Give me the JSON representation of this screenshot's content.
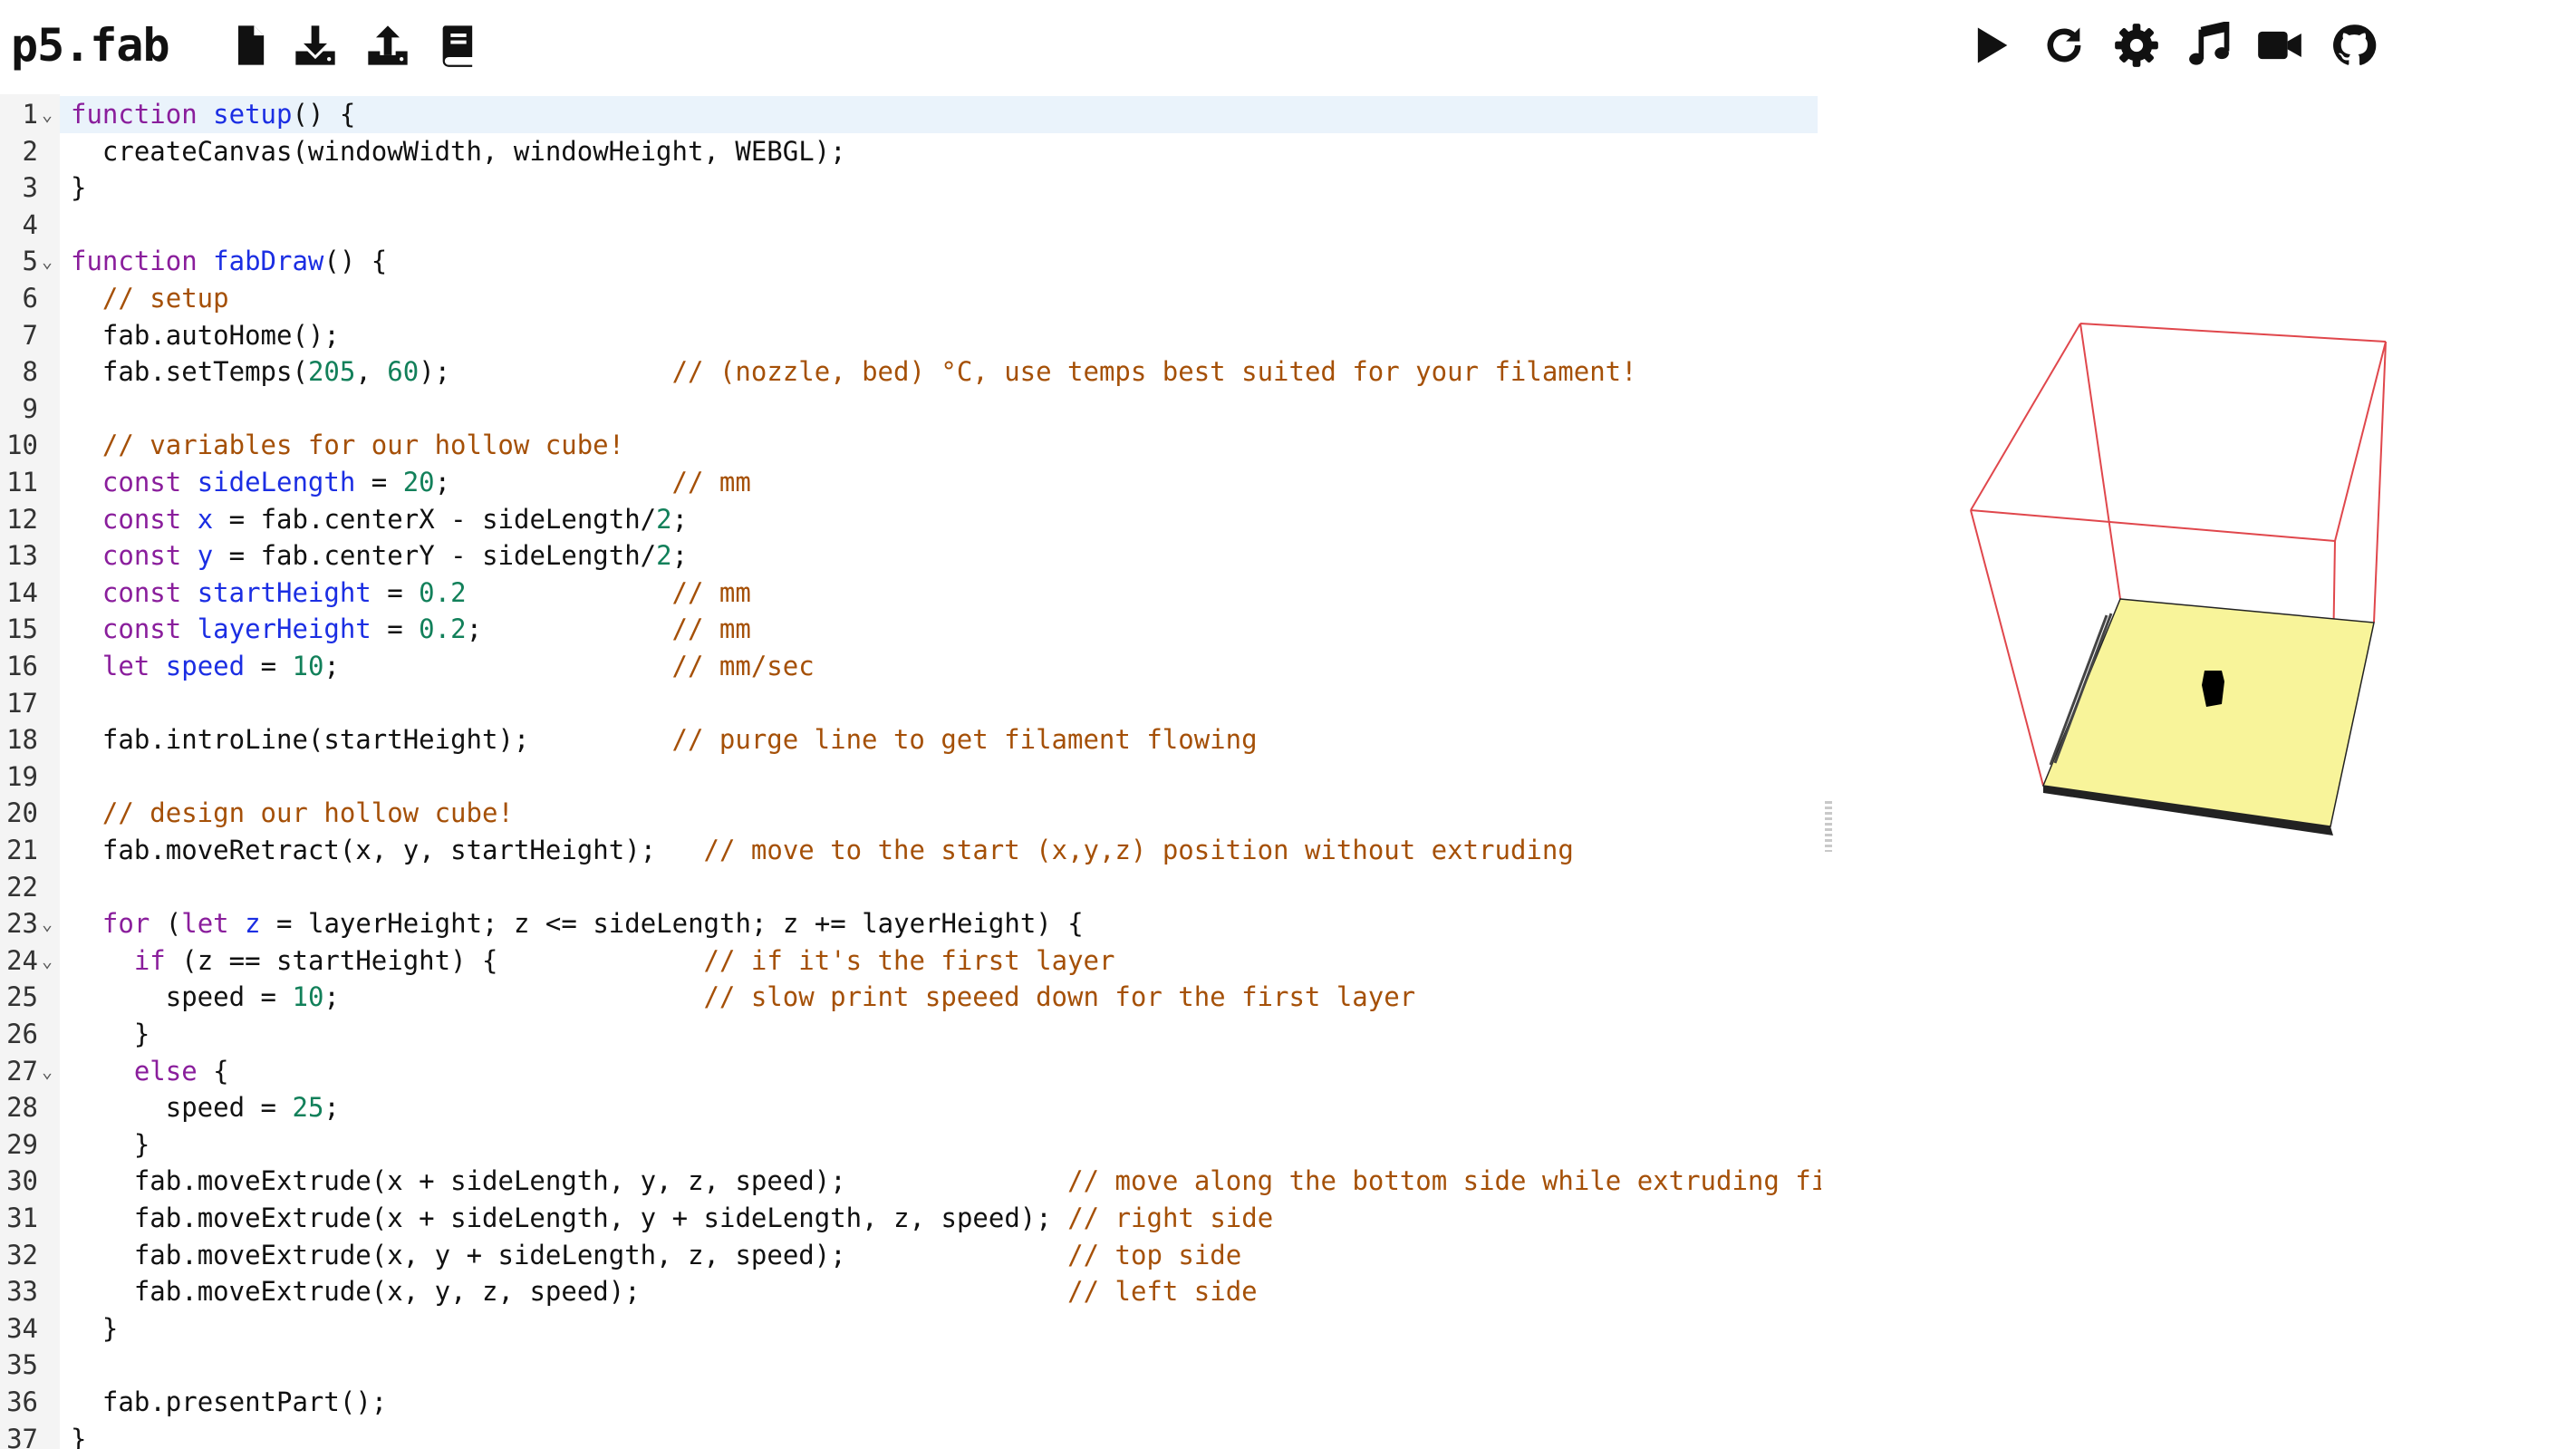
{
  "app": {
    "brand": "p5.fab"
  },
  "toolbar_left": [
    {
      "icon": "new-file-icon"
    },
    {
      "icon": "download-icon"
    },
    {
      "icon": "upload-icon"
    },
    {
      "icon": "book-icon"
    }
  ],
  "toolbar_right": [
    {
      "icon": "play-icon"
    },
    {
      "icon": "refresh-icon"
    },
    {
      "icon": "gear-icon"
    },
    {
      "icon": "music-note-icon"
    },
    {
      "icon": "video-camera-icon"
    },
    {
      "icon": "github-icon"
    }
  ],
  "editor": {
    "active_line": 1,
    "fold_lines": [
      1,
      5,
      23,
      24,
      27
    ],
    "lines": [
      "function setup() {",
      "  createCanvas(windowWidth, windowHeight, WEBGL);",
      "}",
      "",
      "function fabDraw() {",
      "  // setup",
      "  fab.autoHome();",
      "  fab.setTemps(205, 60);              // (nozzle, bed) °C, use temps best suited for your filament!",
      "",
      "  // variables for our hollow cube!",
      "  const sideLength = 20;              // mm",
      "  const x = fab.centerX - sideLength/2;",
      "  const y = fab.centerY - sideLength/2;",
      "  const startHeight = 0.2             // mm",
      "  const layerHeight = 0.2;            // mm",
      "  let speed = 10;                     // mm/sec",
      "",
      "  fab.introLine(startHeight);         // purge line to get filament flowing",
      "",
      "  // design our hollow cube!",
      "  fab.moveRetract(x, y, startHeight);   // move to the start (x,y,z) position without extruding",
      "",
      "  for (let z = layerHeight; z <= sideLength; z += layerHeight) {",
      "    if (z == startHeight) {             // if it's the first layer",
      "      speed = 10;                       // slow print speeed down for the first layer",
      "    }",
      "    else {",
      "      speed = 25;",
      "    }",
      "    fab.moveExtrude(x + sideLength, y, z, speed);              // move along the bottom side while extruding fi",
      "    fab.moveExtrude(x + sideLength, y + sideLength, z, speed); // right side",
      "    fab.moveExtrude(x, y + sideLength, z, speed);              // top side",
      "    fab.moveExtrude(x, y, z, speed);                           // left side",
      "  }",
      "",
      "  fab.presentPart();",
      "}"
    ]
  },
  "colors": {
    "keyword": "#8a1e9c",
    "definition": "#1b2ee3",
    "number": "#12805a",
    "comment": "#a55007",
    "bed_fill": "#f8f49a",
    "build_volume": "#e0474c",
    "active_line_bg": "#eaf3fb"
  }
}
